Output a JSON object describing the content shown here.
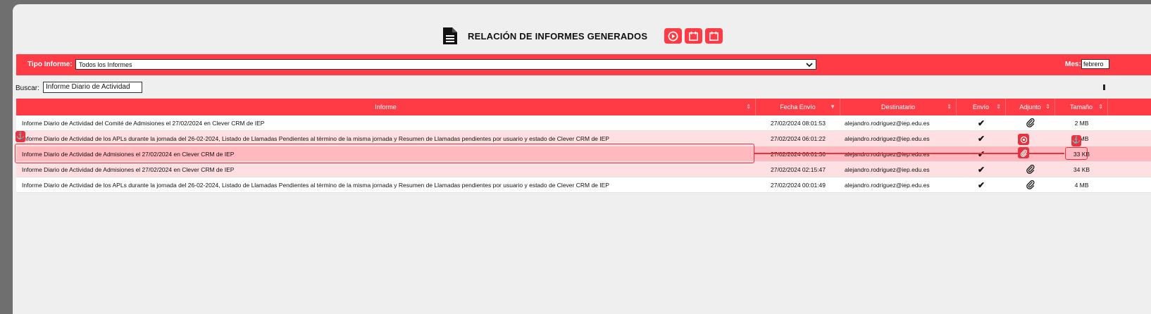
{
  "header": {
    "title": "RELACIÓN DE INFORMES GENERADOS",
    "icons": [
      "document-icon",
      "play-circle-icon",
      "calendar-icon",
      "calendar-icon"
    ]
  },
  "filters": {
    "type_label": "Tipo Informe:",
    "type_value": "Todos los Informes",
    "month_label": "Mes:",
    "month_value": "febrero"
  },
  "search": {
    "label": "Buscar:",
    "value": "Informe Diario de Actividad"
  },
  "table": {
    "columns": {
      "informe": "Informe",
      "fecha": "Fecha Envío",
      "destinatario": "Destinatario",
      "envio": "Envío",
      "adjunto": "Adjunto",
      "tamano": "Tamaño"
    },
    "rows": [
      {
        "informe": "Informe Diario de Actividad del Comité de Admisiones el 27/02/2024 en Clever CRM de IEP",
        "fecha": "27/02/2024 08:01:53",
        "destinatario": "alejandro.rodriguez@iep.edu.es",
        "tamano": "2 MB"
      },
      {
        "informe": "Informe Diario de Actividad de los APLs durante la jornada del 26-02-2024, Listado de Llamadas Pendientes al término de la misma jornada y Resumen de Llamadas pendientes por usuario y estado de Clever CRM de IEP",
        "fecha": "27/02/2024 06:01:22",
        "destinatario": "alejandro.rodriguez@iep.edu.es",
        "tamano": "4 MB"
      },
      {
        "informe": "Informe Diario de Actividad de Admisiones el 27/02/2024 en Clever CRM de IEP",
        "fecha": "27/02/2024 06:01:36",
        "destinatario": "alejandro.rodriguez@iep.edu.es",
        "tamano": "33 KB"
      },
      {
        "informe": "Informe Diario de Actividad de Admisiones el 27/02/2024 en Clever CRM de IEP",
        "fecha": "27/02/2024 02:15:47",
        "destinatario": "alejandro.rodriguez@iep.edu.es",
        "tamano": "34 KB"
      },
      {
        "informe": "Informe Diario de Actividad de los APLs durante la jornada del 26-02-2024, Listado de Llamadas Pendientes al término de la misma jornada y Resumen de Llamadas pendientes por usuario y estado de Clever CRM de IEP",
        "fecha": "27/02/2024 00:01:49",
        "destinatario": "alejandro.rodriguez@iep.edu.es",
        "tamano": "4 MB"
      }
    ]
  },
  "colors": {
    "accent": "#ff3b45",
    "row_alt": "#ffe0e2",
    "row_selected": "#ffb9bf",
    "background": "#efefef"
  }
}
